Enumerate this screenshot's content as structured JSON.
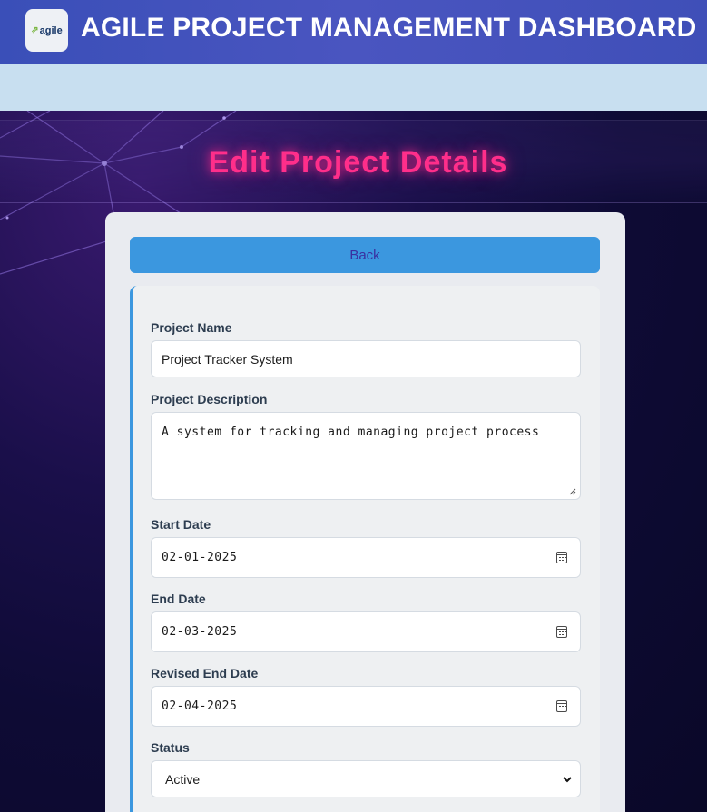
{
  "header": {
    "logo_text": "agile",
    "app_title": "AGILE PROJECT MANAGEMENT DASHBOARD"
  },
  "page": {
    "heading": "Edit Project Details"
  },
  "form": {
    "back_label": "Back",
    "project_name": {
      "label": "Project Name",
      "value": "Project Tracker System"
    },
    "project_description": {
      "label": "Project Description",
      "value": "A system for tracking and managing project process"
    },
    "start_date": {
      "label": "Start Date",
      "value": "02-01-2025"
    },
    "end_date": {
      "label": "End Date",
      "value": "02-03-2025"
    },
    "revised_end_date": {
      "label": "Revised End Date",
      "value": "02-04-2025"
    },
    "status": {
      "label": "Status",
      "value": "Active"
    }
  },
  "icons": {
    "logo": "agile-logo-icon",
    "calendar": "calendar-icon",
    "select": "chevron-down-icon",
    "resize": "resize-handle-icon"
  },
  "colors": {
    "header_bg": "#4a55c0",
    "subbar_bg": "#c8dff0",
    "heading_glow": "#ff2e8a",
    "accent": "#3b97df"
  }
}
